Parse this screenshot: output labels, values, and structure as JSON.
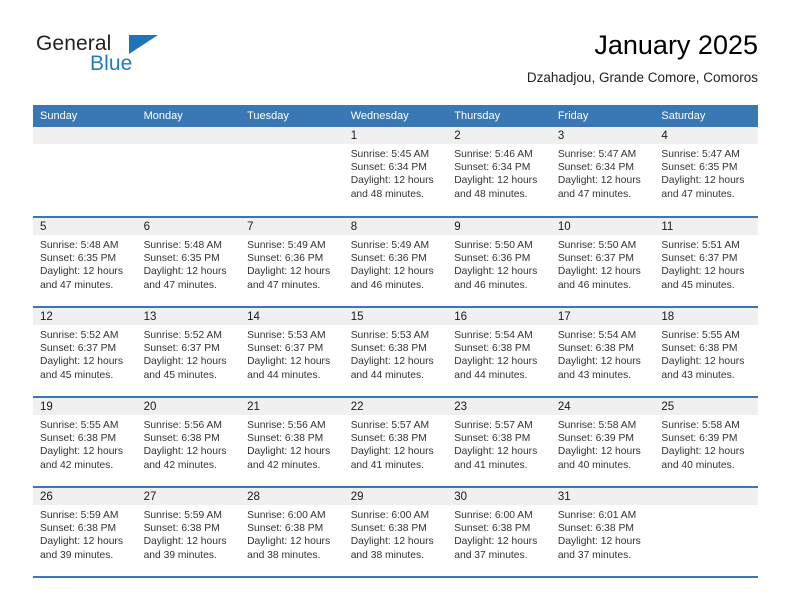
{
  "brand": {
    "name_part1": "General",
    "name_part2": "Blue",
    "triangle_color": "#1f73b8",
    "blue_text_color": "#1f7cc4"
  },
  "header": {
    "title": "January 2025",
    "subtitle": "Dzahadjou, Grande Comore, Comoros"
  },
  "theme": {
    "header_blue": "#3a78b5",
    "daynum_band": "#f0f0f0",
    "cell_border": "#3a78b5"
  },
  "weekdays": [
    "Sunday",
    "Monday",
    "Tuesday",
    "Wednesday",
    "Thursday",
    "Friday",
    "Saturday"
  ],
  "labels": {
    "sunrise_prefix": "Sunrise:",
    "sunset_prefix": "Sunset:",
    "daylight_prefix": "Daylight:"
  },
  "weeks": [
    [
      {
        "blank": true
      },
      {
        "blank": true
      },
      {
        "blank": true
      },
      {
        "day": "1",
        "sunrise": "Sunrise: 5:45 AM",
        "sunset": "Sunset: 6:34 PM",
        "daylight": "Daylight: 12 hours and 48 minutes."
      },
      {
        "day": "2",
        "sunrise": "Sunrise: 5:46 AM",
        "sunset": "Sunset: 6:34 PM",
        "daylight": "Daylight: 12 hours and 48 minutes."
      },
      {
        "day": "3",
        "sunrise": "Sunrise: 5:47 AM",
        "sunset": "Sunset: 6:34 PM",
        "daylight": "Daylight: 12 hours and 47 minutes."
      },
      {
        "day": "4",
        "sunrise": "Sunrise: 5:47 AM",
        "sunset": "Sunset: 6:35 PM",
        "daylight": "Daylight: 12 hours and 47 minutes."
      }
    ],
    [
      {
        "day": "5",
        "sunrise": "Sunrise: 5:48 AM",
        "sunset": "Sunset: 6:35 PM",
        "daylight": "Daylight: 12 hours and 47 minutes."
      },
      {
        "day": "6",
        "sunrise": "Sunrise: 5:48 AM",
        "sunset": "Sunset: 6:35 PM",
        "daylight": "Daylight: 12 hours and 47 minutes."
      },
      {
        "day": "7",
        "sunrise": "Sunrise: 5:49 AM",
        "sunset": "Sunset: 6:36 PM",
        "daylight": "Daylight: 12 hours and 47 minutes."
      },
      {
        "day": "8",
        "sunrise": "Sunrise: 5:49 AM",
        "sunset": "Sunset: 6:36 PM",
        "daylight": "Daylight: 12 hours and 46 minutes."
      },
      {
        "day": "9",
        "sunrise": "Sunrise: 5:50 AM",
        "sunset": "Sunset: 6:36 PM",
        "daylight": "Daylight: 12 hours and 46 minutes."
      },
      {
        "day": "10",
        "sunrise": "Sunrise: 5:50 AM",
        "sunset": "Sunset: 6:37 PM",
        "daylight": "Daylight: 12 hours and 46 minutes."
      },
      {
        "day": "11",
        "sunrise": "Sunrise: 5:51 AM",
        "sunset": "Sunset: 6:37 PM",
        "daylight": "Daylight: 12 hours and 45 minutes."
      }
    ],
    [
      {
        "day": "12",
        "sunrise": "Sunrise: 5:52 AM",
        "sunset": "Sunset: 6:37 PM",
        "daylight": "Daylight: 12 hours and 45 minutes."
      },
      {
        "day": "13",
        "sunrise": "Sunrise: 5:52 AM",
        "sunset": "Sunset: 6:37 PM",
        "daylight": "Daylight: 12 hours and 45 minutes."
      },
      {
        "day": "14",
        "sunrise": "Sunrise: 5:53 AM",
        "sunset": "Sunset: 6:37 PM",
        "daylight": "Daylight: 12 hours and 44 minutes."
      },
      {
        "day": "15",
        "sunrise": "Sunrise: 5:53 AM",
        "sunset": "Sunset: 6:38 PM",
        "daylight": "Daylight: 12 hours and 44 minutes."
      },
      {
        "day": "16",
        "sunrise": "Sunrise: 5:54 AM",
        "sunset": "Sunset: 6:38 PM",
        "daylight": "Daylight: 12 hours and 44 minutes."
      },
      {
        "day": "17",
        "sunrise": "Sunrise: 5:54 AM",
        "sunset": "Sunset: 6:38 PM",
        "daylight": "Daylight: 12 hours and 43 minutes."
      },
      {
        "day": "18",
        "sunrise": "Sunrise: 5:55 AM",
        "sunset": "Sunset: 6:38 PM",
        "daylight": "Daylight: 12 hours and 43 minutes."
      }
    ],
    [
      {
        "day": "19",
        "sunrise": "Sunrise: 5:55 AM",
        "sunset": "Sunset: 6:38 PM",
        "daylight": "Daylight: 12 hours and 42 minutes."
      },
      {
        "day": "20",
        "sunrise": "Sunrise: 5:56 AM",
        "sunset": "Sunset: 6:38 PM",
        "daylight": "Daylight: 12 hours and 42 minutes."
      },
      {
        "day": "21",
        "sunrise": "Sunrise: 5:56 AM",
        "sunset": "Sunset: 6:38 PM",
        "daylight": "Daylight: 12 hours and 42 minutes."
      },
      {
        "day": "22",
        "sunrise": "Sunrise: 5:57 AM",
        "sunset": "Sunset: 6:38 PM",
        "daylight": "Daylight: 12 hours and 41 minutes."
      },
      {
        "day": "23",
        "sunrise": "Sunrise: 5:57 AM",
        "sunset": "Sunset: 6:38 PM",
        "daylight": "Daylight: 12 hours and 41 minutes."
      },
      {
        "day": "24",
        "sunrise": "Sunrise: 5:58 AM",
        "sunset": "Sunset: 6:39 PM",
        "daylight": "Daylight: 12 hours and 40 minutes."
      },
      {
        "day": "25",
        "sunrise": "Sunrise: 5:58 AM",
        "sunset": "Sunset: 6:39 PM",
        "daylight": "Daylight: 12 hours and 40 minutes."
      }
    ],
    [
      {
        "day": "26",
        "sunrise": "Sunrise: 5:59 AM",
        "sunset": "Sunset: 6:38 PM",
        "daylight": "Daylight: 12 hours and 39 minutes."
      },
      {
        "day": "27",
        "sunrise": "Sunrise: 5:59 AM",
        "sunset": "Sunset: 6:38 PM",
        "daylight": "Daylight: 12 hours and 39 minutes."
      },
      {
        "day": "28",
        "sunrise": "Sunrise: 6:00 AM",
        "sunset": "Sunset: 6:38 PM",
        "daylight": "Daylight: 12 hours and 38 minutes."
      },
      {
        "day": "29",
        "sunrise": "Sunrise: 6:00 AM",
        "sunset": "Sunset: 6:38 PM",
        "daylight": "Daylight: 12 hours and 38 minutes."
      },
      {
        "day": "30",
        "sunrise": "Sunrise: 6:00 AM",
        "sunset": "Sunset: 6:38 PM",
        "daylight": "Daylight: 12 hours and 37 minutes."
      },
      {
        "day": "31",
        "sunrise": "Sunrise: 6:01 AM",
        "sunset": "Sunset: 6:38 PM",
        "daylight": "Daylight: 12 hours and 37 minutes."
      },
      {
        "blank": true
      }
    ]
  ]
}
